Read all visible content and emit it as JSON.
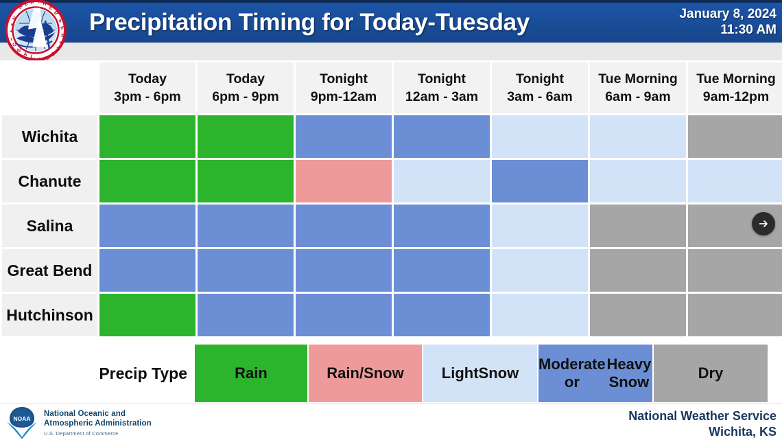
{
  "header": {
    "title": "Precipitation Timing for Today-Tuesday",
    "date": "January 8, 2024",
    "time": "11:30 AM",
    "logo_alt": "National Weather Service seal",
    "bar_color": "#1a4f9c"
  },
  "table": {
    "corner_label": "",
    "columns": [
      {
        "period": "Today",
        "hours": "3pm - 6pm"
      },
      {
        "period": "Today",
        "hours": "6pm - 9pm"
      },
      {
        "period": "Tonight",
        "hours": "9pm-12am"
      },
      {
        "period": "Tonight",
        "hours": "12am - 3am"
      },
      {
        "period": "Tonight",
        "hours": "3am - 6am"
      },
      {
        "period": "Tue Morning",
        "hours": "6am - 9am"
      },
      {
        "period": "Tue Morning",
        "hours": "9am-12pm"
      }
    ],
    "rows": [
      {
        "location": "Wichita",
        "cells": [
          "rain",
          "rain",
          "heavy",
          "heavy",
          "light",
          "light",
          "dry"
        ]
      },
      {
        "location": "Chanute",
        "cells": [
          "rain",
          "rain",
          "rainsnow",
          "light",
          "heavy",
          "light",
          "light"
        ]
      },
      {
        "location": "Salina",
        "cells": [
          "heavy",
          "heavy",
          "heavy",
          "heavy",
          "light",
          "dry",
          "dry"
        ]
      },
      {
        "location": "Great Bend",
        "cells": [
          "heavy",
          "heavy",
          "heavy",
          "heavy",
          "light",
          "dry",
          "dry"
        ]
      },
      {
        "location": "Hutchinson",
        "cells": [
          "rain",
          "heavy",
          "heavy",
          "heavy",
          "light",
          "dry",
          "dry"
        ]
      }
    ]
  },
  "legend": {
    "label": "Precip Type",
    "items": [
      {
        "key": "rain",
        "label": "Rain",
        "color": "#2cb42c"
      },
      {
        "key": "rainsnow",
        "label": "Rain/\nSnow",
        "color": "#ef9a9a"
      },
      {
        "key": "light",
        "label": "Light\nSnow",
        "color": "#d2e3f7"
      },
      {
        "key": "heavy",
        "label": "Moderate or\nHeavy Snow",
        "color": "#6b8ed4"
      },
      {
        "key": "dry",
        "label": "Dry",
        "color": "#a6a6a6"
      }
    ]
  },
  "footer": {
    "noaa_line1": "National Oceanic and",
    "noaa_line2": "Atmospheric Administration",
    "noaa_line3": "U.S. Department of Commerce",
    "nws_line1": "National Weather Service",
    "nws_line2": "Wichita, KS"
  },
  "overlay": {
    "next_arrow": "→"
  }
}
